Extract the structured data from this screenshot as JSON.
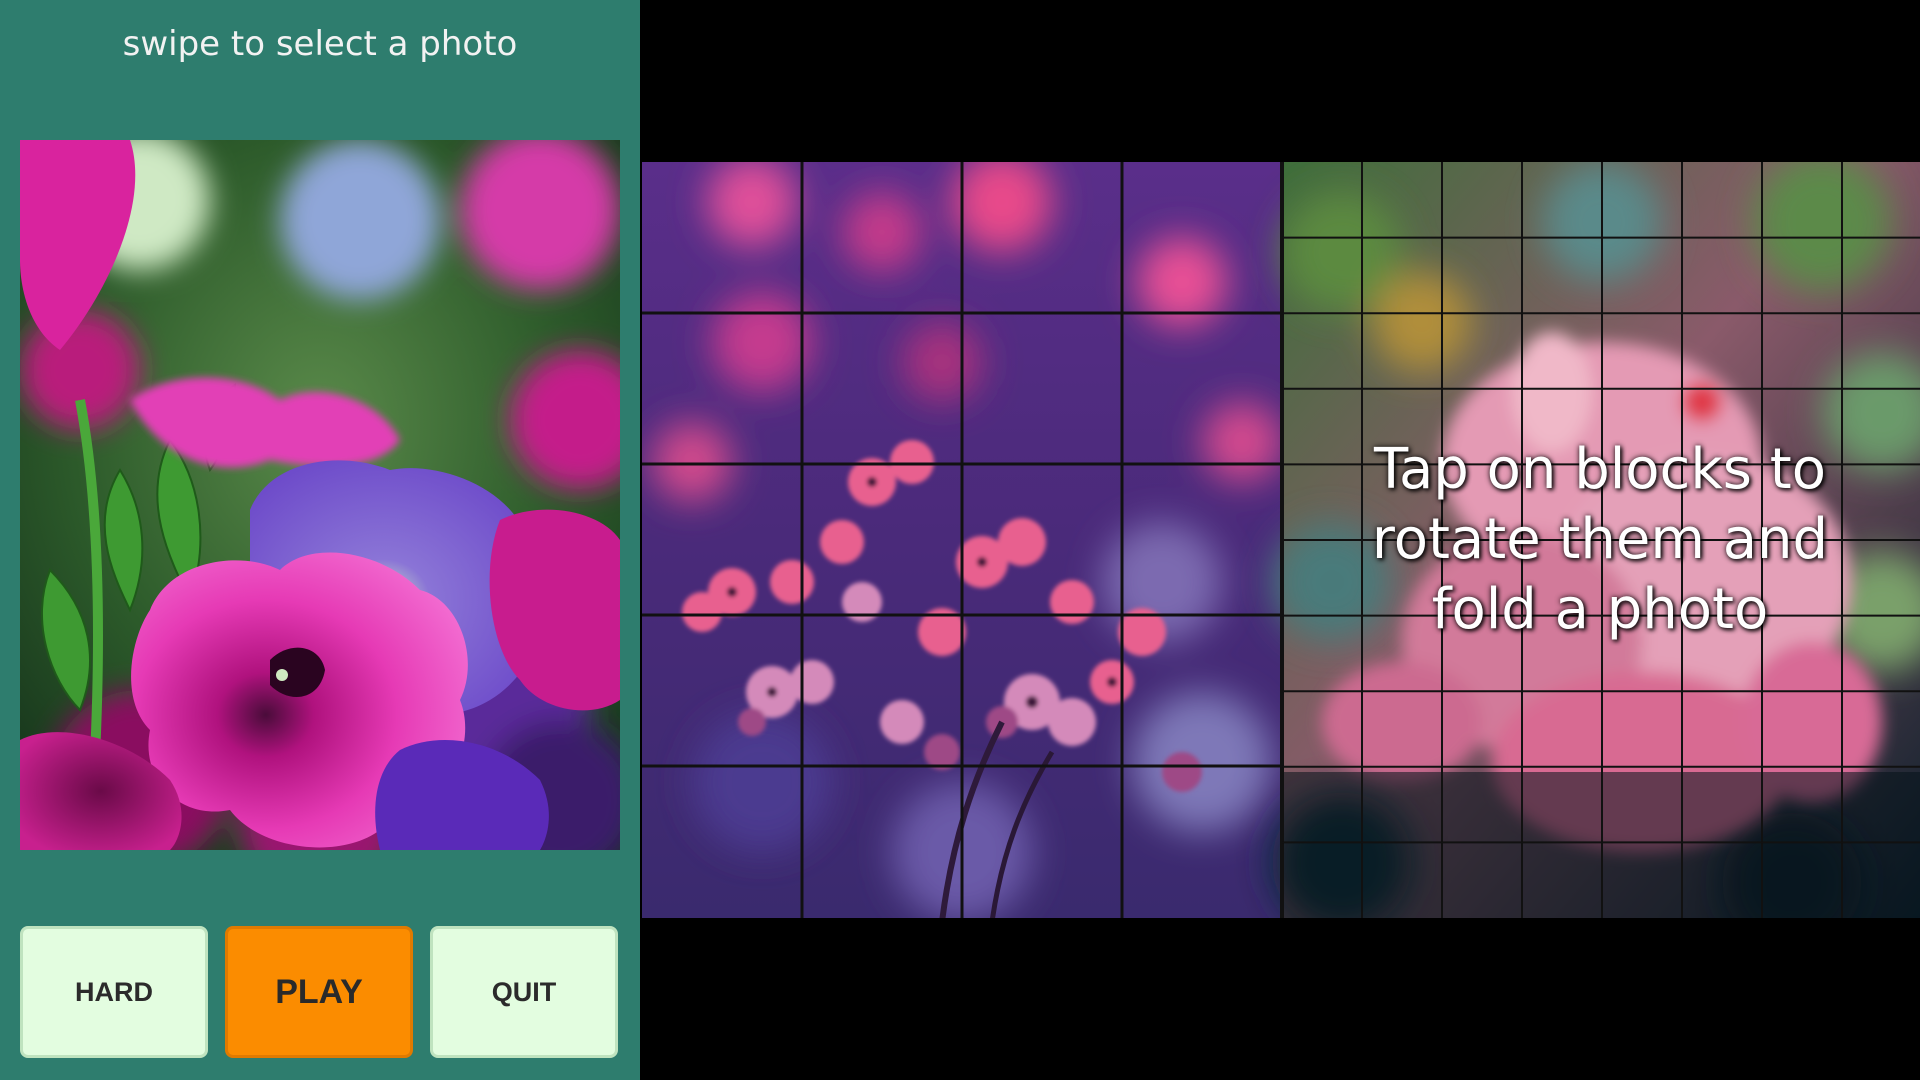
{
  "app": {
    "hint": "swipe to select a photo",
    "instruction": "Tap on blocks to rotate them and fold a photo"
  },
  "buttons": {
    "hard_label": "HARD",
    "play_label": "PLAY",
    "quit_label": "QUIT"
  },
  "colors": {
    "panel": "#2e7d6e",
    "button_bg": "#e3fde0",
    "play_accent": "#fb8c00",
    "background": "#000000"
  },
  "puzzle": {
    "photo_a_grid": {
      "cols": 4,
      "rows": 5
    },
    "photo_b_grid": {
      "cols": 8,
      "rows": 10
    }
  }
}
